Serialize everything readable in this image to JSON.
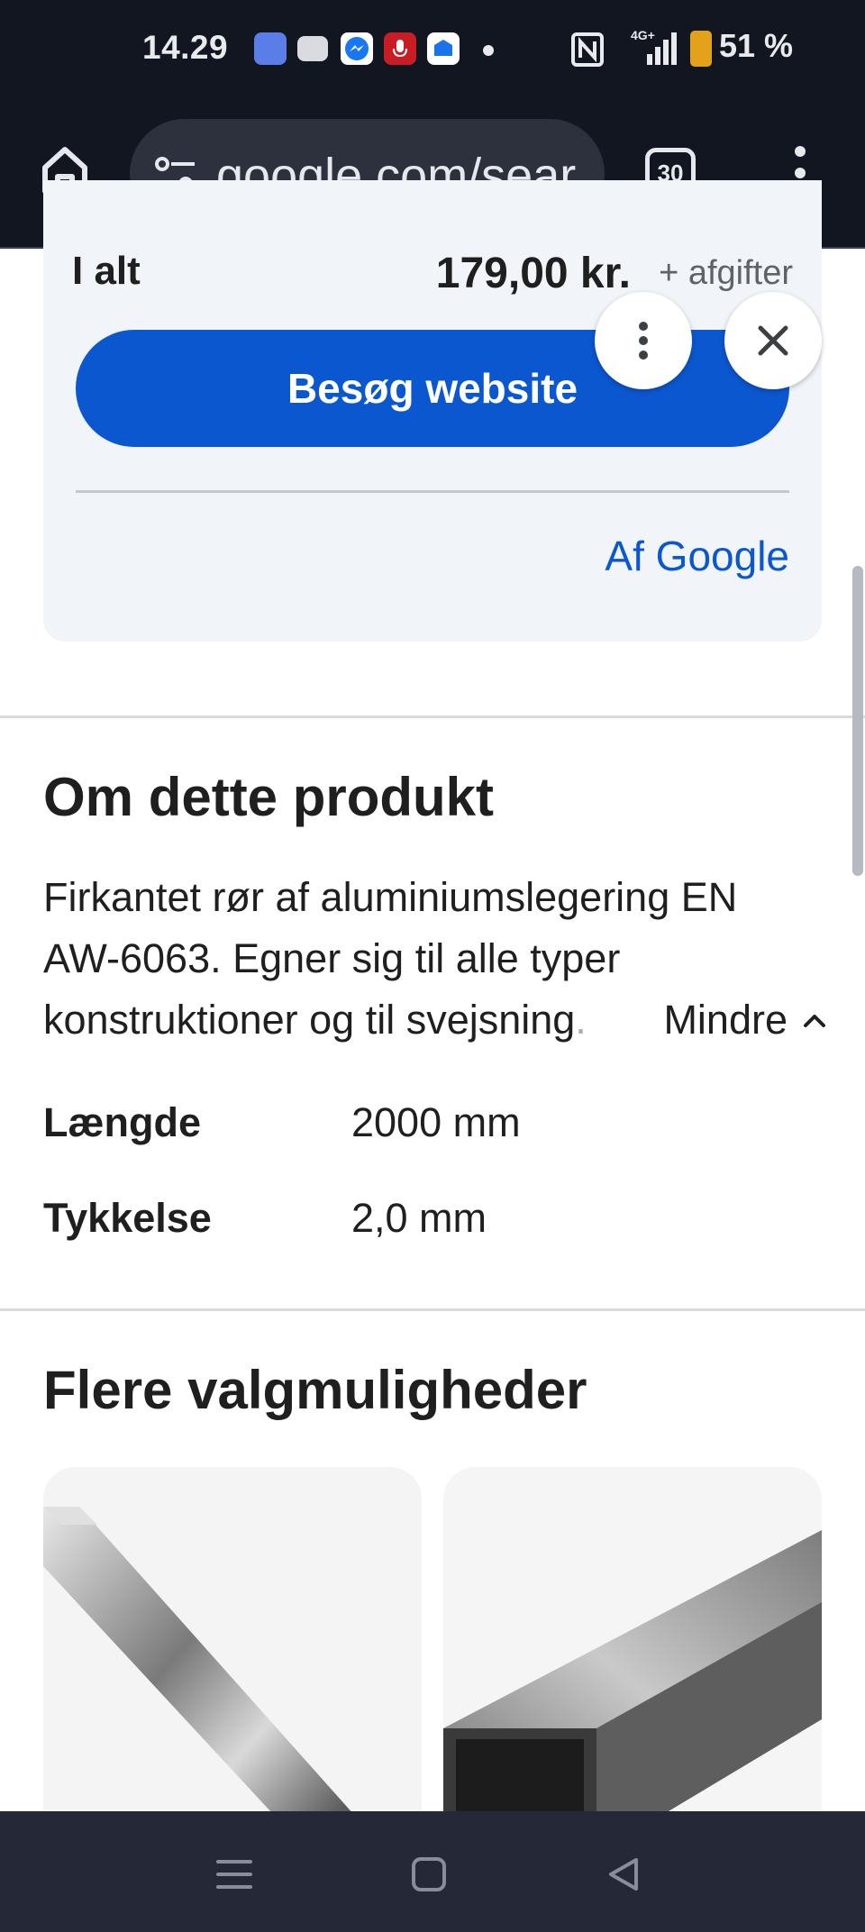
{
  "status_bar": {
    "time": "14.29",
    "network": "4G+",
    "battery": "51 %"
  },
  "browser": {
    "url": "google.com/sear",
    "tab_count": "30"
  },
  "price_card": {
    "total_label": "I alt",
    "total_price": "179,00 kr.",
    "fees": "+ afgifter",
    "visit_button": "Besøg website",
    "by_google": "Af Google"
  },
  "product": {
    "heading": "Om dette produkt",
    "description_line1": "Firkantet rør af aluminiumslegering EN",
    "description_line2": "AW-6063. Egner sig til alle typer",
    "description_line3": "konstruktioner og til svejsning",
    "description_fade": ".",
    "less_label": "Mindre",
    "specs": [
      {
        "key": "Længde",
        "value": "2000 mm"
      },
      {
        "key": "Tykkelse",
        "value": "2,0 mm"
      }
    ]
  },
  "more_options": {
    "heading": "Flere valgmuligheder"
  },
  "colors": {
    "accent": "#0b57d0",
    "toolbar": "#121620",
    "navbar": "#252837",
    "card_bg": "#f1f4f9"
  }
}
